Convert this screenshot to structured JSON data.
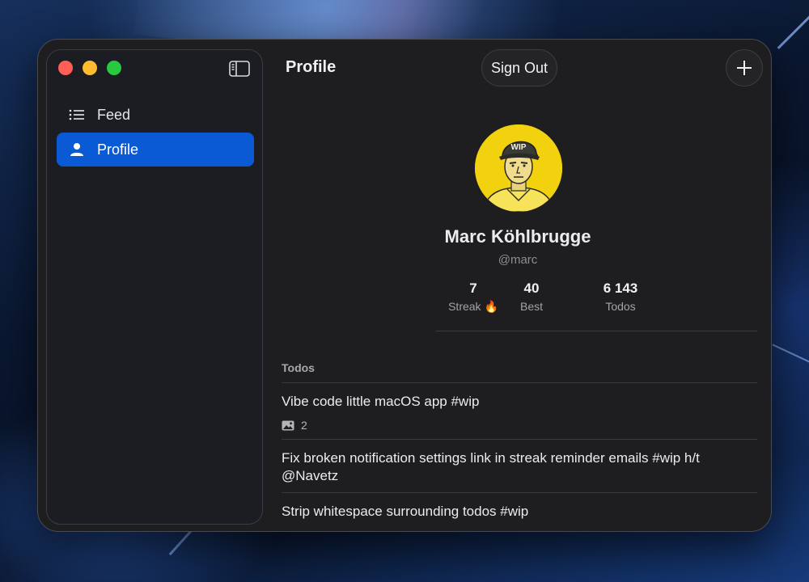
{
  "window": {
    "title": "Profile",
    "sign_out_label": "Sign Out"
  },
  "sidebar": {
    "items": [
      {
        "label": "Feed",
        "icon": "list-icon",
        "active": false
      },
      {
        "label": "Profile",
        "icon": "person-icon",
        "active": true
      }
    ]
  },
  "profile": {
    "name": "Marc Köhlbrugge",
    "handle": "@marc",
    "avatar_cap_text": "WIP",
    "stats": [
      {
        "value": "7",
        "label": "Streak 🔥"
      },
      {
        "value": "40",
        "label": "Best"
      },
      {
        "value": "6 143",
        "label": "Todos"
      }
    ]
  },
  "todos": {
    "header": "Todos",
    "items": [
      {
        "text": "Vibe code little macOS app #wip",
        "attachments": "2"
      },
      {
        "text": "Fix broken notification settings link in streak reminder emails #wip h/t @Navetz"
      },
      {
        "text": "Strip whitespace surrounding todos #wip"
      }
    ]
  },
  "colors": {
    "accent": "#0a5ad6",
    "avatar_bg": "#f2d20f",
    "close": "#ff5f57",
    "minimize": "#febc2e",
    "maximize": "#28c840"
  }
}
